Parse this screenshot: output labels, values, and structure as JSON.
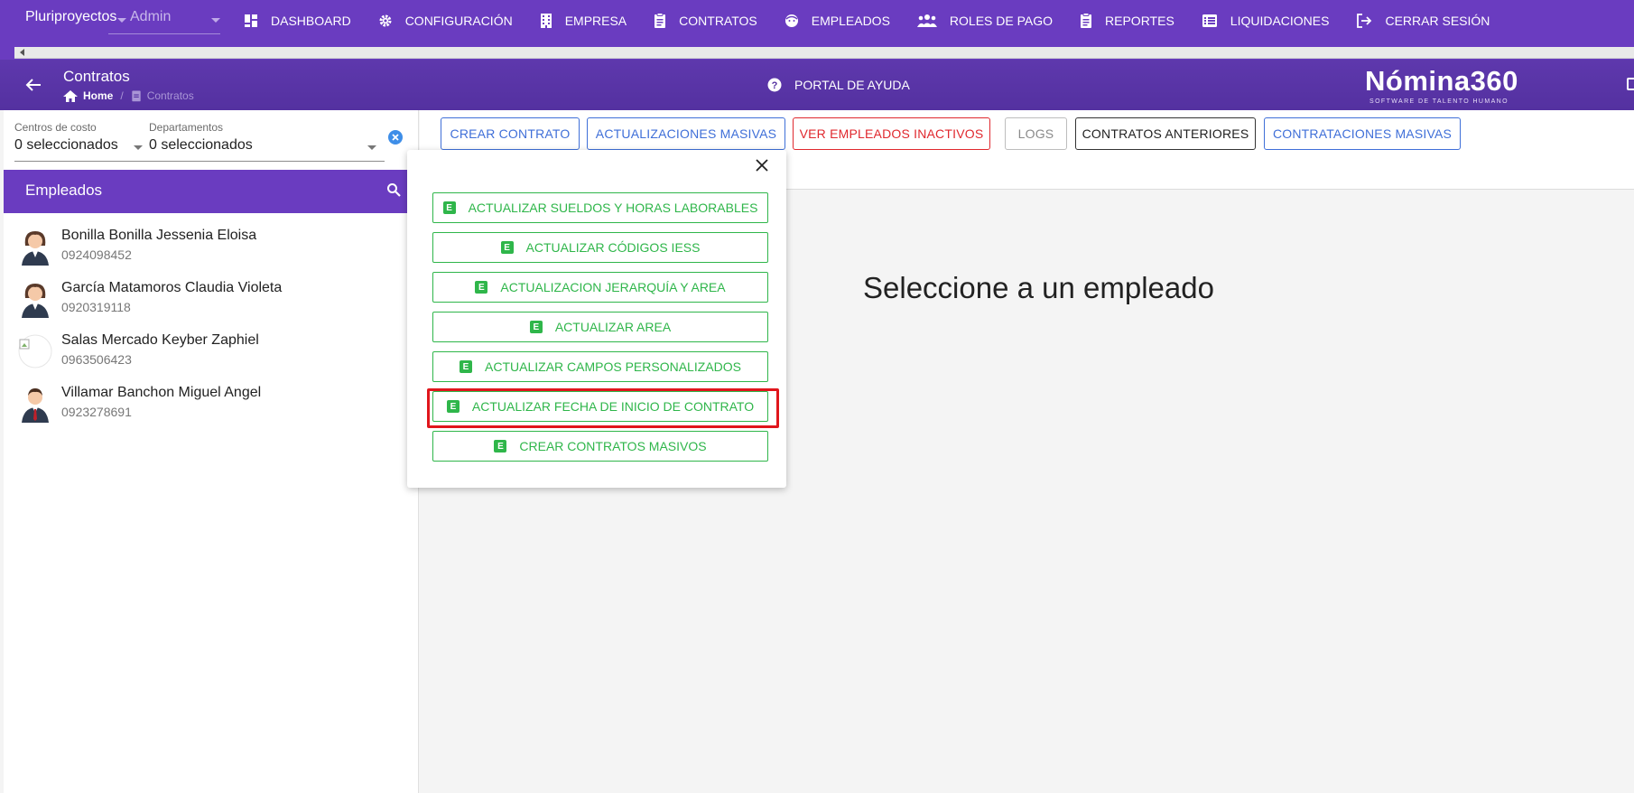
{
  "topnav": {
    "company": "Pluriproyectos",
    "role": "Admin",
    "items": [
      {
        "label": "DASHBOARD",
        "icon": "dashboard-icon"
      },
      {
        "label": "CONFIGURACIÓN",
        "icon": "gear-icon"
      },
      {
        "label": "EMPRESA",
        "icon": "building-icon"
      },
      {
        "label": "CONTRATOS",
        "icon": "clipboard-icon"
      },
      {
        "label": "EMPLEADOS",
        "icon": "face-icon"
      },
      {
        "label": "ROLES DE PAGO",
        "icon": "group-icon"
      },
      {
        "label": "REPORTES",
        "icon": "clipboard-icon"
      },
      {
        "label": "LIQUIDACIONES",
        "icon": "list-icon"
      },
      {
        "label": "CERRAR SESIÓN",
        "icon": "logout-icon"
      }
    ]
  },
  "header": {
    "title": "Contratos",
    "breadcrumb_home": "Home",
    "breadcrumb_current": "Contratos",
    "help": "PORTAL DE AYUDA",
    "logo": "Nómina360",
    "logo_sub": "SOFTWARE DE TALENTO HUMANO"
  },
  "filters": {
    "cost_center_label": "Centros de costo",
    "cost_center_value": "0 seleccionados",
    "department_label": "Departamentos",
    "department_value": "0 seleccionados"
  },
  "employees": {
    "title": "Empleados",
    "list": [
      {
        "name": "Bonilla Bonilla Jessenia Eloisa",
        "id": "0924098452",
        "avatar": "female"
      },
      {
        "name": "García Matamoros Claudia Violeta",
        "id": "0920319118",
        "avatar": "female"
      },
      {
        "name": "Salas Mercado Keyber Zaphiel",
        "id": "0963506423",
        "avatar": "broken"
      },
      {
        "name": "Villamar Banchon Miguel Angel",
        "id": "0923278691",
        "avatar": "male"
      }
    ]
  },
  "toolbar": {
    "create": "CREAR CONTRATO",
    "mass_updates": "ACTUALIZACIONES MASIVAS",
    "inactive": "VER EMPLEADOS INACTIVOS",
    "logs": "LOGS",
    "previous": "CONTRATOS ANTERIORES",
    "mass_hiring": "CONTRATACIONES MASIVAS"
  },
  "main": {
    "placeholder": "Seleccione a un empleado"
  },
  "popup": {
    "badge": "E",
    "actions": [
      "ACTUALIZAR SUELDOS Y HORAS LABORABLES",
      "ACTUALIZAR CÓDIGOS IESS",
      "ACTUALIZACION JERARQUÍA Y AREA",
      "ACTUALIZAR AREA",
      "ACTUALIZAR CAMPOS PERSONALIZADOS",
      "ACTUALIZAR FECHA DE INICIO DE CONTRATO",
      "CREAR CONTRATOS MASIVOS"
    ]
  },
  "colors": {
    "primary": "#6a3cc0",
    "blue": "#3f6fd8",
    "red": "#e0282e",
    "green": "#2fb64a"
  }
}
